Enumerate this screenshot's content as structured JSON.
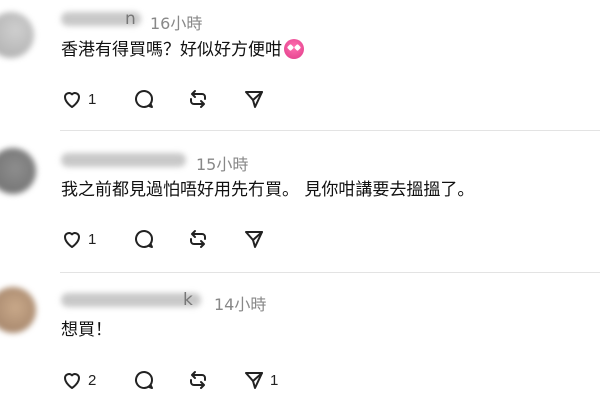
{
  "comments": [
    {
      "username_suffix": "n",
      "time": "16小時",
      "text": "香港有得買嗎？好似好方便咁",
      "emoji": "smiling-face-with-heart-eyes",
      "likes": "1",
      "reposts": "",
      "shares": ""
    },
    {
      "username_suffix": "",
      "time": "15小時",
      "text": "我之前都見過怕唔好用先冇買。 見你咁講要去搵搵了。",
      "likes": "1",
      "reposts": "",
      "shares": ""
    },
    {
      "username_suffix": "k",
      "time": "14小時",
      "text": "想買！",
      "likes": "2",
      "reposts": "",
      "shares": "1"
    }
  ]
}
